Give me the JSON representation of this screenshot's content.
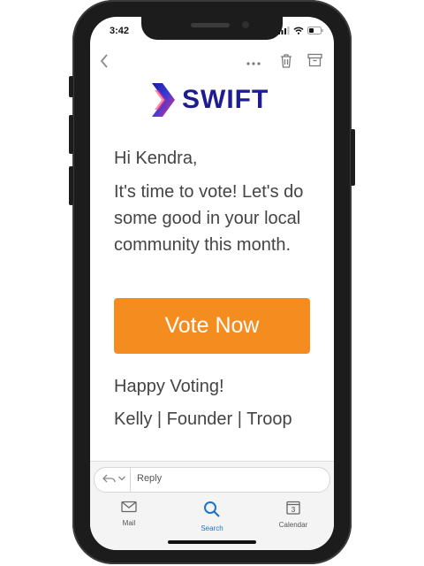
{
  "status_bar": {
    "time": "3:42"
  },
  "toolbar": {
    "back_icon": "chevron-left-icon",
    "more_icon": "ellipsis-icon",
    "trash_icon": "trash-icon",
    "archive_icon": "archive-icon"
  },
  "email": {
    "brand": "SWIFT",
    "greeting": "Hi Kendra,",
    "message": "It's time to vote! Let's do some good in your local community this month.",
    "cta_label": "Vote Now",
    "closing": "Happy Voting!",
    "signature": "Kelly | Founder | Troop"
  },
  "reply_bar": {
    "placeholder": "Reply"
  },
  "tab_bar": {
    "tabs": [
      {
        "label": "Mail",
        "icon": "mail-icon",
        "active": false
      },
      {
        "label": "Search",
        "icon": "search-icon",
        "active": true
      },
      {
        "label": "Calendar",
        "icon": "calendar-icon",
        "calendar_day": "3",
        "active": false
      }
    ]
  },
  "colors": {
    "brand": "#1e1d8f",
    "cta": "#f48c20",
    "active_tab": "#1b74c9"
  }
}
